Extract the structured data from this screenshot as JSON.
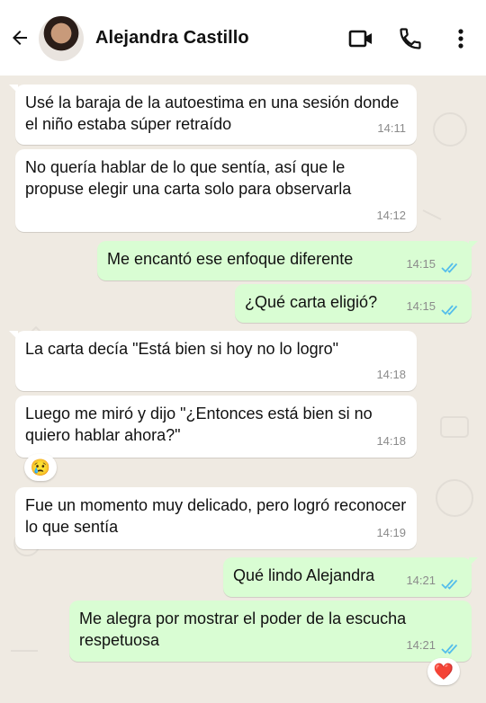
{
  "contact": {
    "name": "Alejandra Castillo"
  },
  "icons": {
    "back": "arrow-left-icon",
    "video": "video-call-icon",
    "call": "phone-icon",
    "menu": "more-vertical-icon"
  },
  "colors": {
    "incoming": "#ffffff",
    "outgoing": "#d9fdd3",
    "ticks": "#53bdeb",
    "background": "#efeae2"
  },
  "messages": [
    {
      "dir": "in",
      "text": "Usé la baraja de la autoestima en una sesión donde el niño estaba súper retraído",
      "time": "14:11"
    },
    {
      "dir": "in",
      "text": "No quería hablar de lo que sentía, así que le propuse elegir una carta solo para observarla",
      "time": "14:12"
    },
    {
      "dir": "out",
      "text": "Me encantó ese enfoque diferente",
      "time": "14:15"
    },
    {
      "dir": "out",
      "text": "¿Qué carta eligió?",
      "time": "14:15"
    },
    {
      "dir": "in",
      "text": "La carta decía \"Está bien si hoy no lo logro\"",
      "time": "14:18"
    },
    {
      "dir": "in",
      "text": "Luego me miró y dijo \"¿Entonces está bien si no quiero hablar ahora?\"",
      "time": "14:18",
      "reaction": "😢"
    },
    {
      "dir": "in",
      "text": "Fue un momento muy delicado, pero logró reconocer lo que sentía",
      "time": "14:19"
    },
    {
      "dir": "out",
      "text": "Qué lindo Alejandra",
      "time": "14:21"
    },
    {
      "dir": "out",
      "text": "Me alegra por mostrar el poder de la escucha respetuosa",
      "time": "14:21",
      "reaction": "❤️"
    }
  ]
}
